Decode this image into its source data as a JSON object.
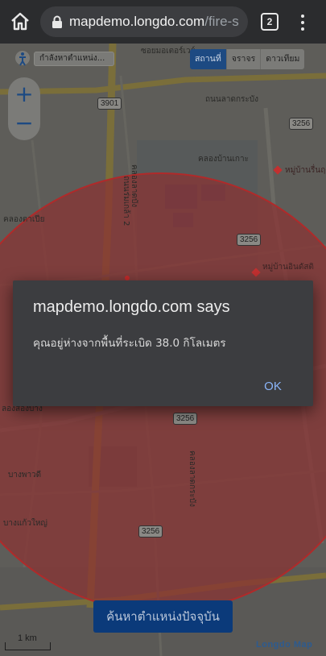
{
  "browser": {
    "url_host": "mapdemo.longdo.com",
    "url_path": "/fire-s",
    "tab_count": "2"
  },
  "map": {
    "search_placeholder": "กำลังหาตำแหน่ง...",
    "layer_tabs": [
      {
        "label": "สถานที่",
        "active": true
      },
      {
        "label": "จราจร",
        "active": false
      },
      {
        "label": "ดาวเทียม",
        "active": false
      }
    ],
    "zoom_in": "+",
    "zoom_out": "−",
    "locate_button": "ค้นหาตำแหน่งปัจจุบัน",
    "scale_label": "1 km",
    "brand": "Longdo Map",
    "labels": {
      "road_top": "ถนนลาดกระบัง",
      "road_top2": "ซอยมอเตอร์เวย์",
      "canal_1": "คลองบ้านเกาะ",
      "canal_2": "คลองตาเปีย",
      "canal_3": "คลองลาดบัง",
      "road_vertical": "ถนนร่มเกล้า 2",
      "village_1": "หมู่บ้านรื่นฤดี",
      "village_2": "หมู่บ้านอินดัสติ",
      "left_1": "ลองสองบาง",
      "left_2": "บางพาวดี",
      "left_3": "บางแก้วใหญ่",
      "bottom_vertical": "คลองลาดกระบัง"
    },
    "road_shields": {
      "r3901": "3901",
      "r3256a": "3256",
      "r3256b": "3256",
      "r3256c": "3256",
      "r3256d": "3256"
    },
    "colors": {
      "circle_fill": "#8a3232",
      "circle_stroke": "#b02a2a",
      "accent_blue": "#1d4a82"
    }
  },
  "dialog": {
    "title": "mapdemo.longdo.com says",
    "message": "คุณอยู่ห่างจากพื้นที่ระเบิด 38.0 กิโลเมตร",
    "ok": "OK"
  }
}
